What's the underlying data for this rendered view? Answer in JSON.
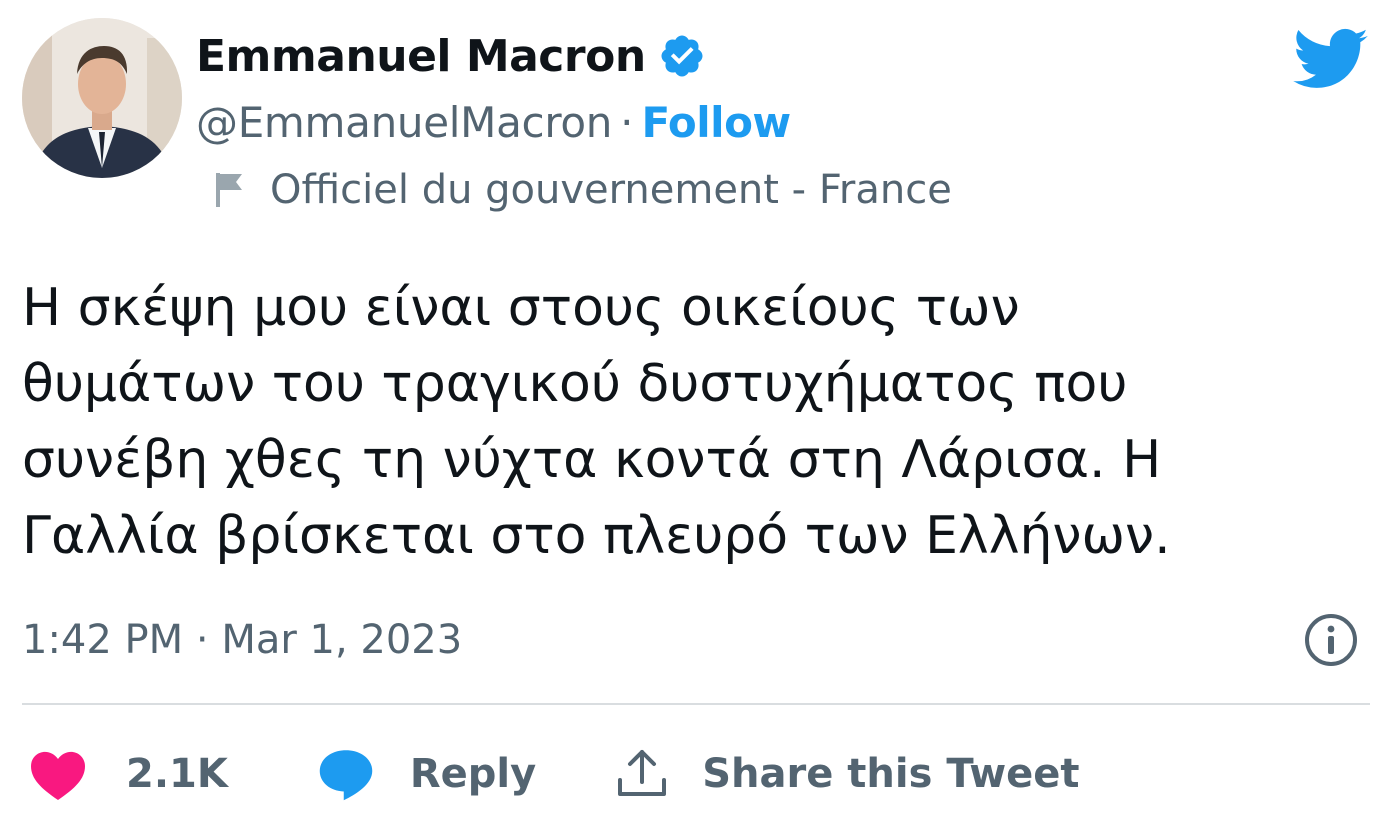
{
  "author": {
    "display_name": "Emmanuel Macron",
    "handle": "@EmmanuelMacron",
    "separator": "·",
    "follow_label": "Follow",
    "verified_icon": "verified-badge-icon",
    "label_icon": "flag-icon",
    "label_text": "Officiel du gouvernement - France"
  },
  "tweet": {
    "lines": [
      "Η σκέψη μου είναι στους οικείους των",
      "θυμάτων του τραγικού δυστυχήματος που",
      "συνέβη χθες τη νύχτα κοντά στη Λάρισα. Η",
      "Γαλλία βρίσκεται στο πλευρό των Ελλήνων."
    ],
    "timestamp": "1:42 PM · Mar 1, 2023"
  },
  "actions": {
    "like_count": "2.1K",
    "reply_label": "Reply",
    "share_label": "Share this Tweet"
  },
  "icons": {
    "brand": "twitter-bird-icon",
    "info": "info-icon",
    "like": "heart-icon",
    "reply": "speech-bubble-icon",
    "share": "share-upload-icon"
  },
  "colors": {
    "accent": "#1d9bf0",
    "text_primary": "#0f1419",
    "text_secondary": "#536471",
    "like": "#f91880",
    "divider": "#d9dde0"
  }
}
